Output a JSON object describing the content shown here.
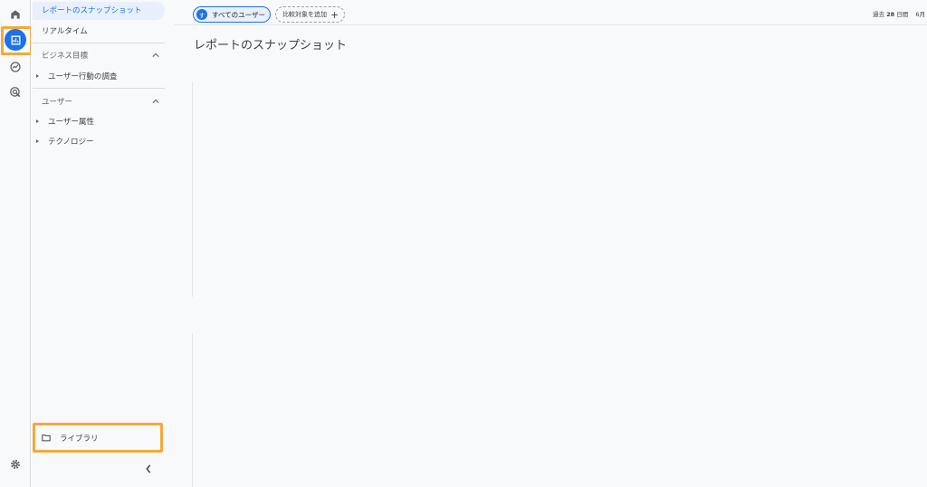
{
  "sidebar": {
    "active_item": "レポートのスナップショット",
    "realtime": "リアルタイム",
    "section_business": "ビジネス目標",
    "business_items": [
      "ユーザー行動の調査"
    ],
    "section_user": "ユーザー",
    "user_items": [
      "ユーザー属性",
      "テクノロジー"
    ],
    "library": "ライブラリ"
  },
  "topbar": {
    "users_chip_letter": "す",
    "users_chip_label": "すべてのユーザー",
    "compare_chip_label": "比較対象を追加",
    "date_prefix": "過去",
    "date_days": "28",
    "date_suffix": "日間",
    "date_cut": "6月"
  },
  "main": {
    "page_title": "レポートのスナップショット"
  },
  "colors": {
    "accent": "#1a73e8",
    "highlight": "#f4a93a"
  }
}
